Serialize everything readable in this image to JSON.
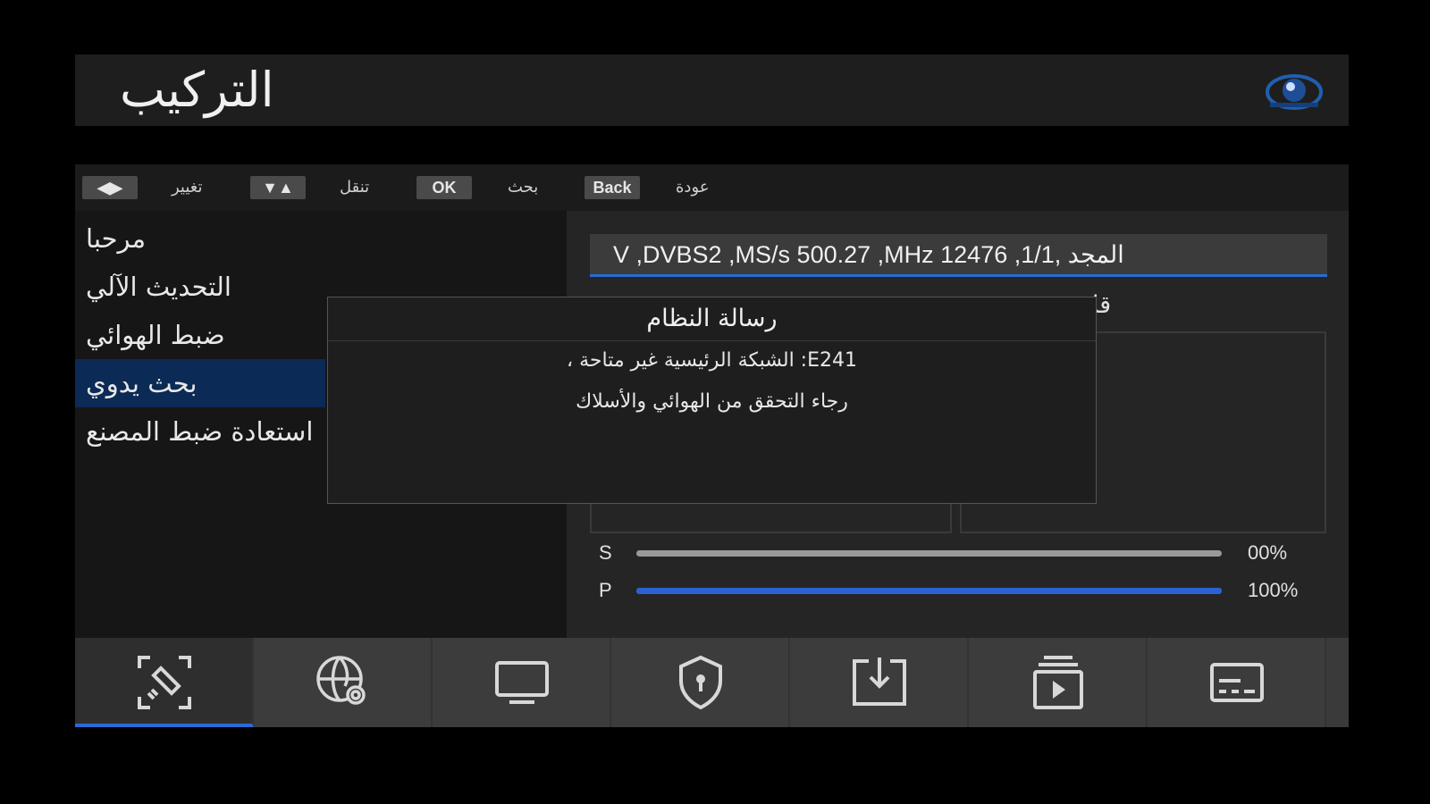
{
  "header": {
    "title": "التركيب",
    "logo_icon": "eye-globe-logo-icon"
  },
  "help_bar": [
    {
      "key": "◀▶",
      "label": "تغيير"
    },
    {
      "key": "▼▲",
      "label": "تنقل"
    },
    {
      "key": "OK",
      "label": "بحث"
    },
    {
      "key": "Back",
      "label": "عودة"
    }
  ],
  "menu": {
    "items": [
      {
        "label": "مرحبا",
        "active": false
      },
      {
        "label": "التحديث الآلي",
        "active": false
      },
      {
        "label": "ضبط الهوائي",
        "active": false
      },
      {
        "label": "بحث يدوي",
        "active": true
      },
      {
        "label": "استعادة ضبط المصنع",
        "active": false
      }
    ]
  },
  "search": {
    "satellite_line": "V ,DVBS2 ,MS/s 500.27 ,MHz 12476 ,المجد ,1/1",
    "quality_label_partial": "قا"
  },
  "signal": {
    "strength": {
      "label": "S",
      "value_text": "00%",
      "fraction": 0.0
    },
    "quality": {
      "label": "P",
      "value_text": "100%",
      "fraction": 1.0
    }
  },
  "dialog": {
    "title": "رسالة النظام",
    "line1": "E241:  الشبكة الرئيسية غير متاحة ،",
    "line2": "رجاء  التحقق من الهوائي والأسلاك"
  },
  "bottom_tabs": [
    {
      "icon": "satellite-icon",
      "active": true
    },
    {
      "icon": "globe-settings-icon",
      "active": false
    },
    {
      "icon": "tv-monitor-icon",
      "active": false
    },
    {
      "icon": "shield-lock-icon",
      "active": false
    },
    {
      "icon": "download-icon",
      "active": false
    },
    {
      "icon": "media-player-icon",
      "active": false
    },
    {
      "icon": "subtitles-icon",
      "active": false
    }
  ],
  "colors": {
    "accent": "#2a6ad6",
    "selected_row": "#0b2a55",
    "background": "#000000"
  }
}
